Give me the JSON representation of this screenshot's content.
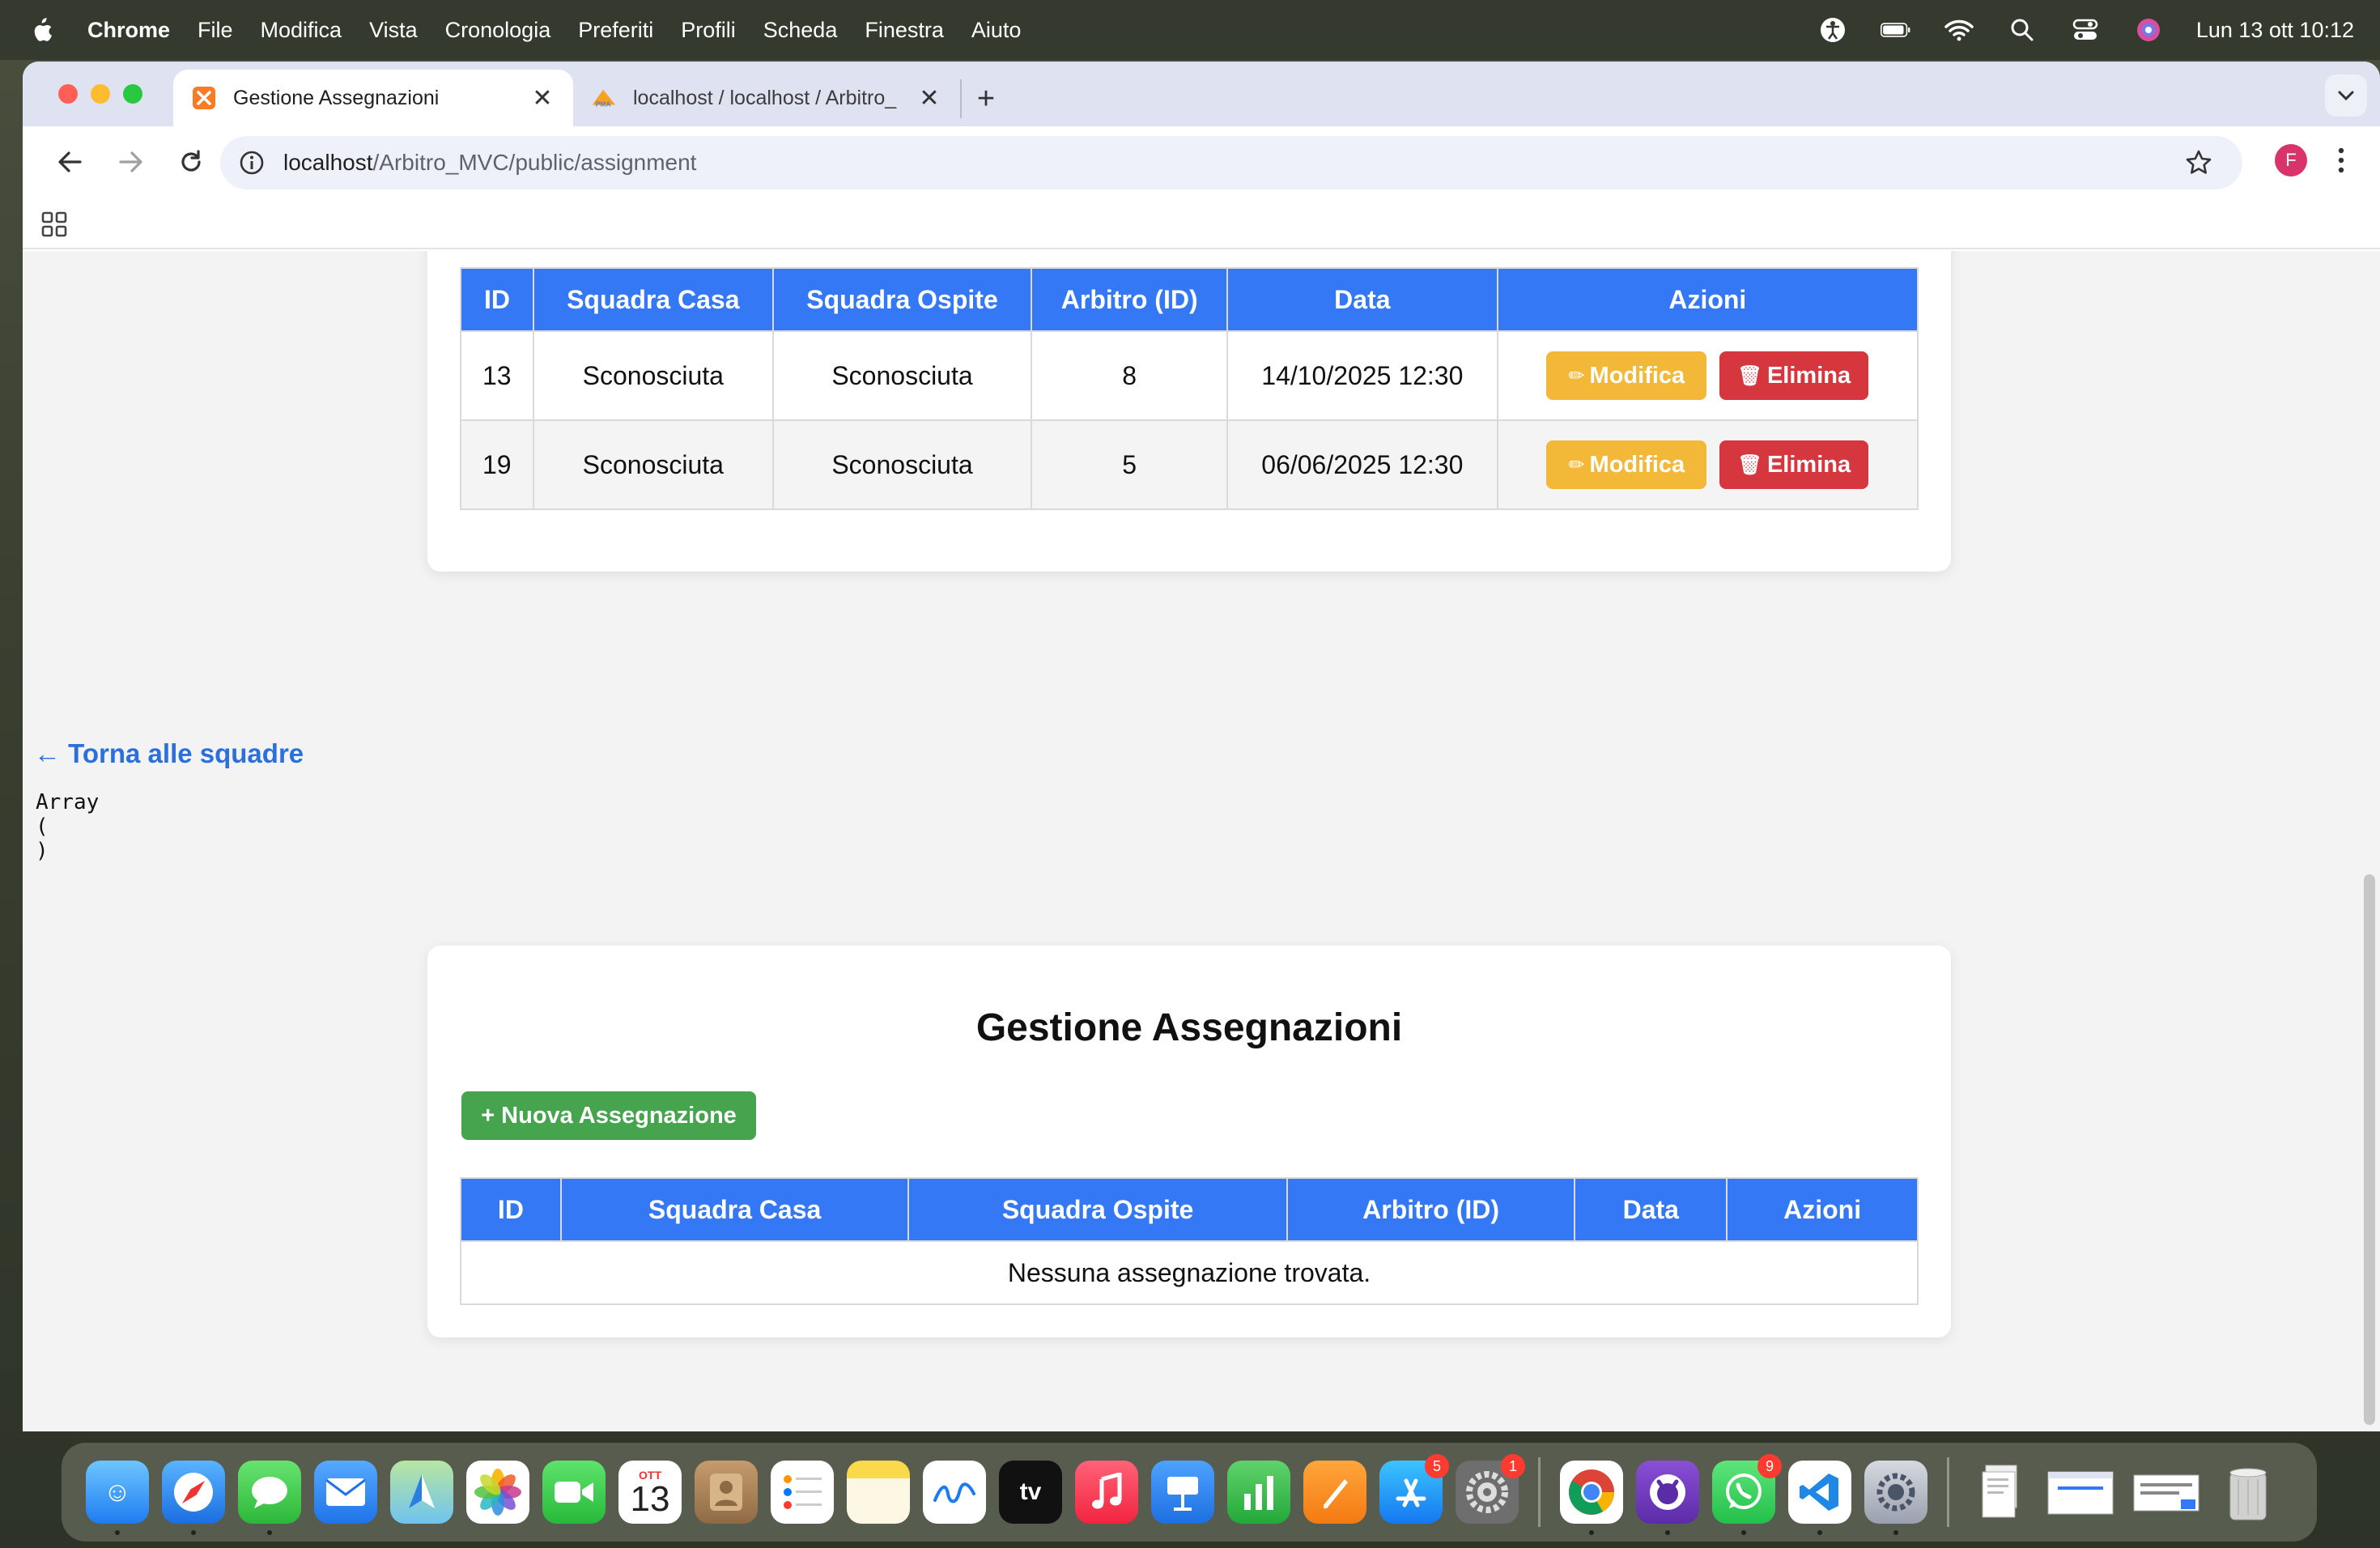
{
  "menubar": {
    "app_name": "Chrome",
    "items": [
      "File",
      "Modifica",
      "Vista",
      "Cronologia",
      "Preferiti",
      "Profili",
      "Scheda",
      "Finestra",
      "Aiuto"
    ],
    "clock": "Lun 13 ott  10:12"
  },
  "browser": {
    "tabs": [
      {
        "title": "Gestione Assegnazioni",
        "active": true
      },
      {
        "title": "localhost / localhost / Arbitro_",
        "active": false
      }
    ],
    "url_host": "localhost",
    "url_path": "/Arbitro_MVC/public/assignment",
    "profile_initial": "F"
  },
  "page": {
    "top_table": {
      "headers": [
        "ID",
        "Squadra Casa",
        "Squadra Ospite",
        "Arbitro (ID)",
        "Data",
        "Azioni"
      ],
      "rows": [
        {
          "id": "13",
          "home": "Sconosciuta",
          "away": "Sconosciuta",
          "referee": "8",
          "date": "14/10/2025 12:30"
        },
        {
          "id": "19",
          "home": "Sconosciuta",
          "away": "Sconosciuta",
          "referee": "5",
          "date": "06/06/2025 12:30"
        }
      ],
      "edit_label": "Modifica",
      "delete_label": "Elimina"
    },
    "back_link": "← Torna alle squadre",
    "debug_output": "Array\n(\n)",
    "section_title": "Gestione Assegnazioni",
    "new_button": "+ Nuova Assegnazione",
    "bottom_table": {
      "headers": [
        "ID",
        "Squadra Casa",
        "Squadra Ospite",
        "Arbitro (ID)",
        "Data",
        "Azioni"
      ],
      "empty_message": "Nessuna assegnazione trovata."
    }
  },
  "dock": {
    "calendar_month": "OTT",
    "calendar_day": "13",
    "badges": {
      "app_store": "5",
      "settings": "1",
      "whatsapp": "9"
    }
  },
  "colors": {
    "accent": "#3478f6",
    "edit": "#f4b839",
    "delete": "#d6363e",
    "new": "#46a34e",
    "link": "#2b6fdc"
  }
}
